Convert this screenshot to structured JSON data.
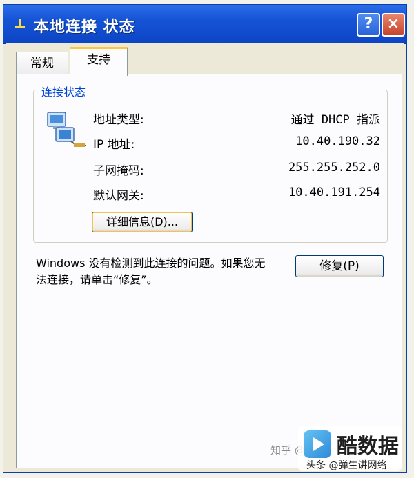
{
  "window": {
    "title": "本地连接 状态",
    "help_glyph": "?",
    "close_glyph": "×"
  },
  "tabs": [
    {
      "label": "常规"
    },
    {
      "label": "支持"
    }
  ],
  "group": {
    "legend": "连接状态",
    "rows": [
      {
        "label": "地址类型:",
        "value": "通过 DHCP 指派"
      },
      {
        "label": "IP 地址:",
        "value": "10.40.190.32"
      },
      {
        "label": "子网掩码:",
        "value": "255.255.252.0"
      },
      {
        "label": "默认网关:",
        "value": "10.40.191.254"
      }
    ],
    "details_button": "详细信息(D)..."
  },
  "repair": {
    "message": "Windows 没有检测到此连接的问题。如果您无法连接，请单击“修复”。",
    "button": "修复(P)"
  },
  "watermark": {
    "text": "知乎 @",
    "logo_text": "酷数据",
    "logo_sub": "头条 @弹生讲网络"
  },
  "colors": {
    "titlebar": "#1553d6",
    "legend": "#0046d5",
    "tab_highlight": "#ffc83c"
  }
}
